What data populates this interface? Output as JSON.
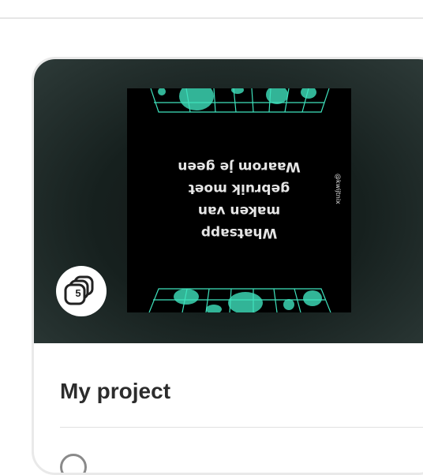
{
  "project": {
    "title": "My project",
    "page_count": "5",
    "thumbnail": {
      "lines": [
        "Whatsapp",
        "maken van",
        "gebruik moet",
        "Waarom je geen"
      ],
      "handle": "@kwijtnix"
    }
  },
  "colors": {
    "accent_neon": "#3fe2bd",
    "media_background": "#16201e",
    "title_text": "#2c2c2c"
  }
}
